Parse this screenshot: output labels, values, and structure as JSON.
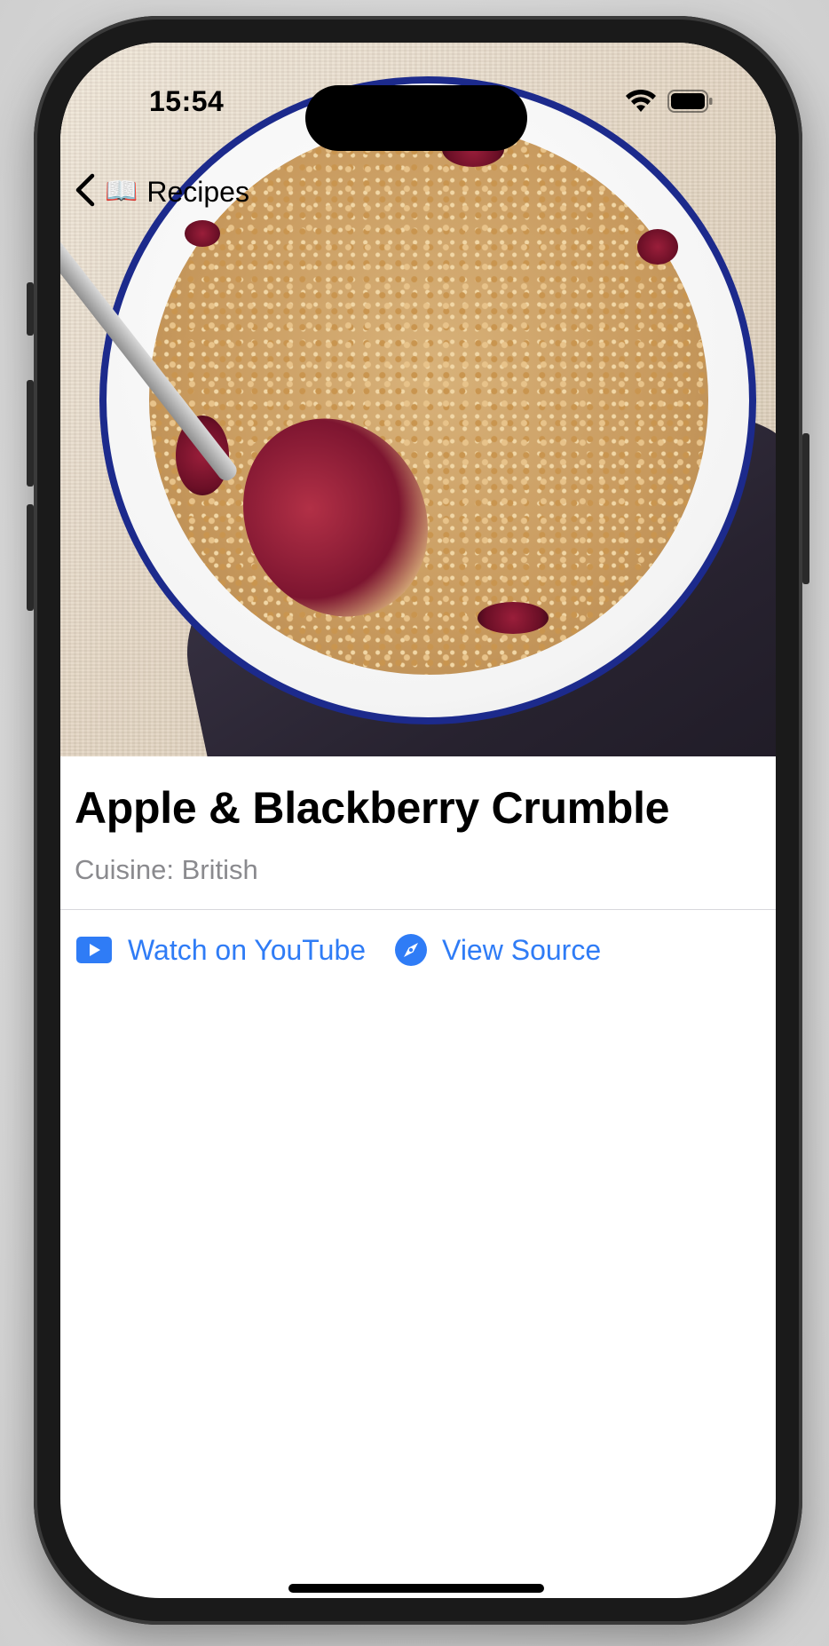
{
  "status_bar": {
    "time": "15:54"
  },
  "nav": {
    "back_icon": "chevron-left-icon",
    "back_emoji": "📖",
    "back_label": "Recipes"
  },
  "recipe": {
    "image_icon": "recipe-photo",
    "title": "Apple & Blackberry Crumble",
    "cuisine": "Cuisine: British"
  },
  "links": {
    "youtube": {
      "icon": "play-rectangle-icon",
      "label": "Watch on YouTube"
    },
    "source": {
      "icon": "safari-compass-icon",
      "label": "View Source"
    }
  },
  "colors": {
    "accent": "#2f7cf6",
    "secondary_text": "#8a8a8e",
    "divider": "#d8d8dc"
  }
}
